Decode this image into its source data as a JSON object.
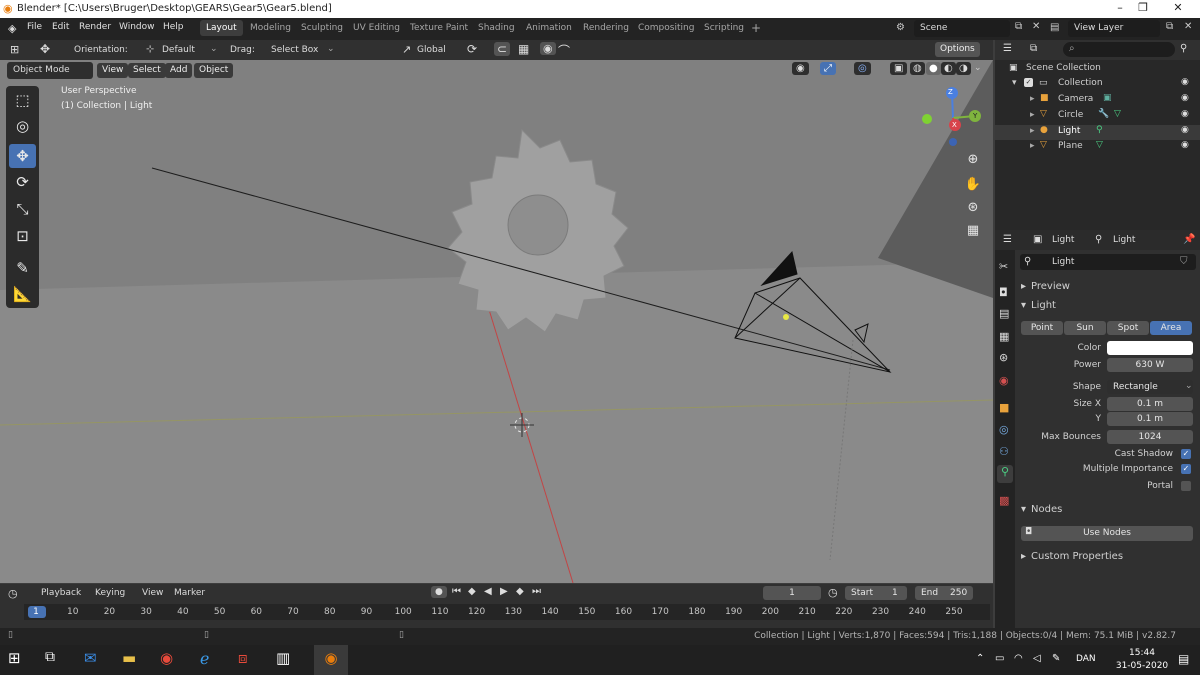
{
  "window": {
    "title": "Blender* [C:\\Users\\Bruger\\Desktop\\GEARS\\Gear5\\Gear5.blend]",
    "controls": [
      "–",
      "❐",
      "✕"
    ]
  },
  "topbar": {
    "menus": [
      "File",
      "Edit",
      "Render",
      "Window",
      "Help"
    ],
    "workspaces": [
      "Layout",
      "Modeling",
      "Sculpting",
      "UV Editing",
      "Texture Paint",
      "Shading",
      "Animation",
      "Rendering",
      "Compositing",
      "Scripting"
    ],
    "active_workspace": "Layout",
    "add_tab": "+",
    "scene_label": "Scene",
    "view_layer_label": "View Layer"
  },
  "viewport_header": {
    "orientation_label": "Orientation:",
    "orientation_value": "Default",
    "drag_label": "Drag:",
    "drag_value": "Select Box",
    "transform_orientation": "Global",
    "options_label": "Options",
    "mode": "Object Mode",
    "menus": [
      "View",
      "Select",
      "Add",
      "Object"
    ]
  },
  "viewport": {
    "view_name": "User Perspective",
    "context": "(1) Collection | Light",
    "gizmo_axes": [
      "Z",
      "X",
      "Y"
    ]
  },
  "outliner": {
    "root": "Scene Collection",
    "collection": "Collection",
    "items": [
      {
        "label": "Camera",
        "color": "#e8a23c"
      },
      {
        "label": "Circle",
        "color": "#e8a23c"
      },
      {
        "label": "Light",
        "color": "#e8a23c"
      },
      {
        "label": "Plane",
        "color": "#e8a23c"
      }
    ]
  },
  "properties": {
    "object_name": "Light",
    "data_name": "Light",
    "datablock": "Light",
    "preview_section": "Preview",
    "light_section": "Light",
    "light_types": [
      "Point",
      "Sun",
      "Spot",
      "Area"
    ],
    "active_type": "Area",
    "color_label": "Color",
    "color_value": "#ffffff",
    "power_label": "Power",
    "power_value": "630 W",
    "shape_label": "Shape",
    "shape_value": "Rectangle",
    "size_x_label": "Size X",
    "size_x_value": "0.1 m",
    "size_y_label": "Y",
    "size_y_value": "0.1 m",
    "max_bounces_label": "Max Bounces",
    "max_bounces_value": "1024",
    "cast_shadow_label": "Cast Shadow",
    "cast_shadow": true,
    "multiple_importance_label": "Multiple Importance",
    "multiple_importance": true,
    "portal_label": "Portal",
    "portal": false,
    "nodes_section": "Nodes",
    "use_nodes_label": "Use Nodes",
    "custom_props_section": "Custom Properties"
  },
  "timeline": {
    "menus": [
      "Playback",
      "Keying",
      "View",
      "Marker"
    ],
    "current_frame": "1",
    "start_label": "Start",
    "start_value": "1",
    "end_label": "End",
    "end_value": "250",
    "ruler": [
      "1",
      "10",
      "20",
      "30",
      "40",
      "50",
      "60",
      "70",
      "80",
      "90",
      "100",
      "110",
      "120",
      "130",
      "140",
      "150",
      "160",
      "170",
      "180",
      "190",
      "200",
      "210",
      "220",
      "230",
      "240",
      "250"
    ]
  },
  "statusbar": {
    "text": "Collection | Light | Verts:1,870 | Faces:594 | Tris:1,188 | Objects:0/4 | Mem: 75.1 MiB | v2.82.7"
  },
  "taskbar": {
    "time": "15:44",
    "date": "31-05-2020",
    "language": "DAN"
  }
}
